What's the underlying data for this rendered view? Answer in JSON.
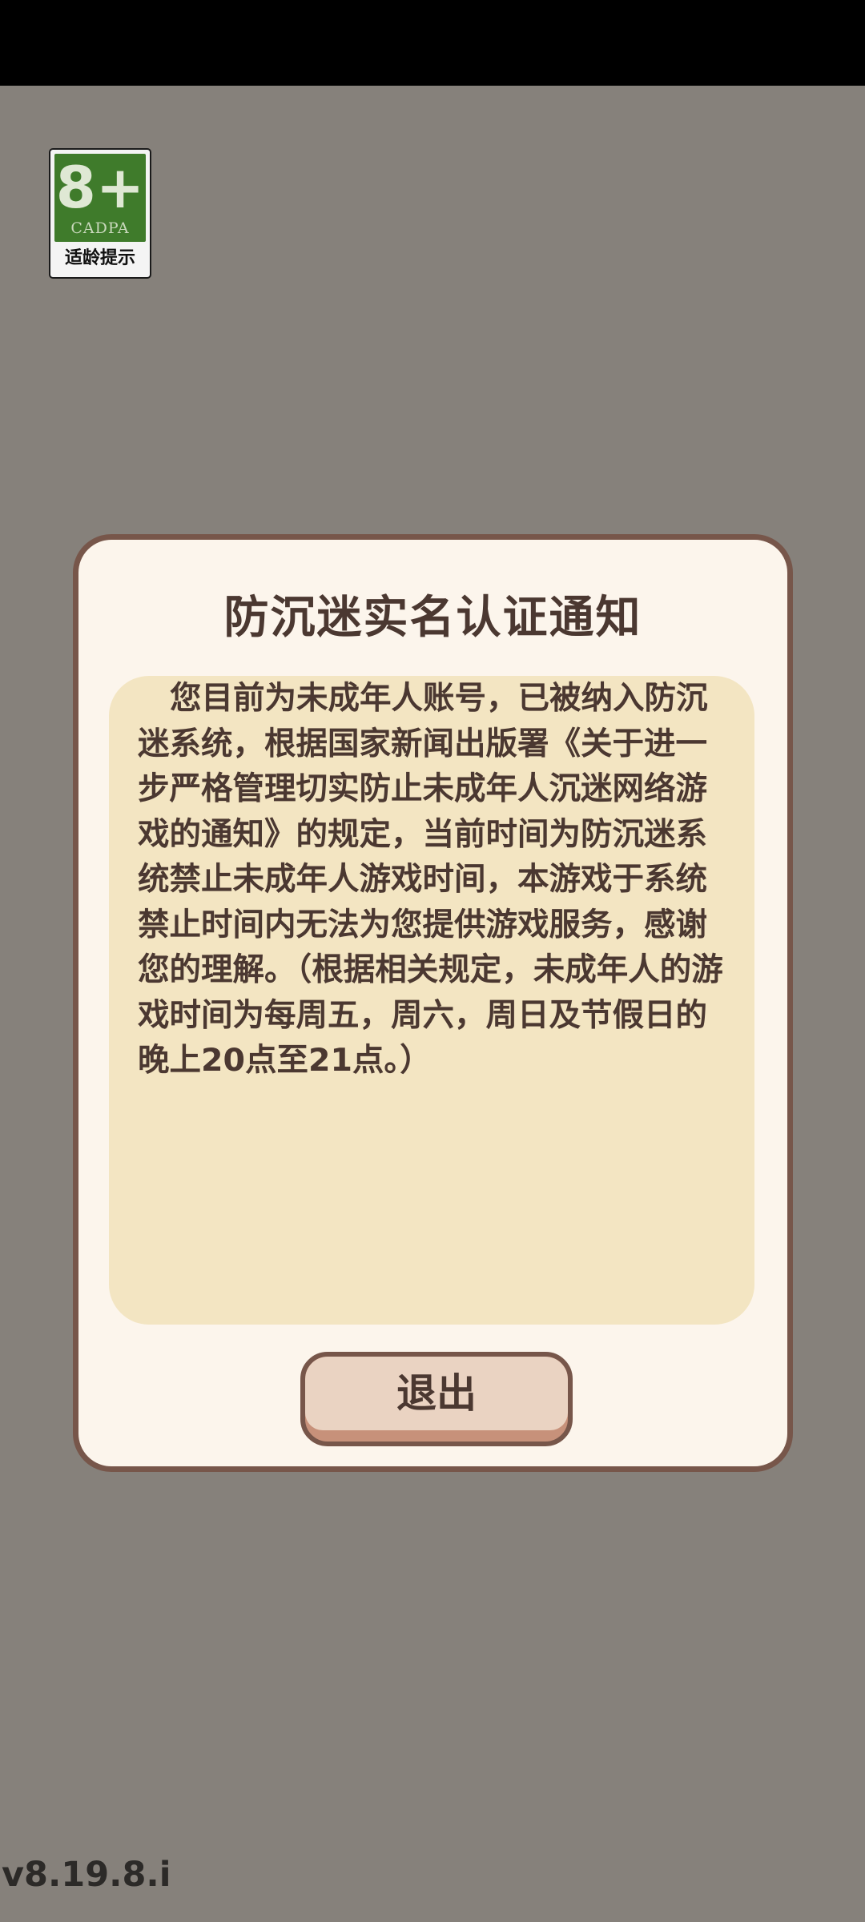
{
  "age_rating": {
    "age": "8+",
    "organization": "CADPA",
    "caption": "适龄提示"
  },
  "dialog": {
    "title": "防沉迷实名认证通知",
    "message": "您目前为未成年人账号，已被纳入防沉迷系统，根据国家新闻出版署《关于进一步严格管理切实防止未成年人沉迷网络游戏的通知》的规定，当前时间为防沉迷系统禁止未成年人游戏时间，本游戏于系统禁止时间内无法为您提供游戏服务，感谢您的理解。（根据相关规定，未成年人的游戏时间为每周五，周六，周日及节假日的晚上20点至21点。）",
    "exit_label": "退出"
  },
  "version": "v8.19.8.i",
  "colors": {
    "background": "#86817b",
    "dialog_bg": "#fcf5ec",
    "dialog_border": "#77564a",
    "notice_bg": "#f3e5c2",
    "text": "#4b3831",
    "badge_green": "#3f7b2b"
  }
}
